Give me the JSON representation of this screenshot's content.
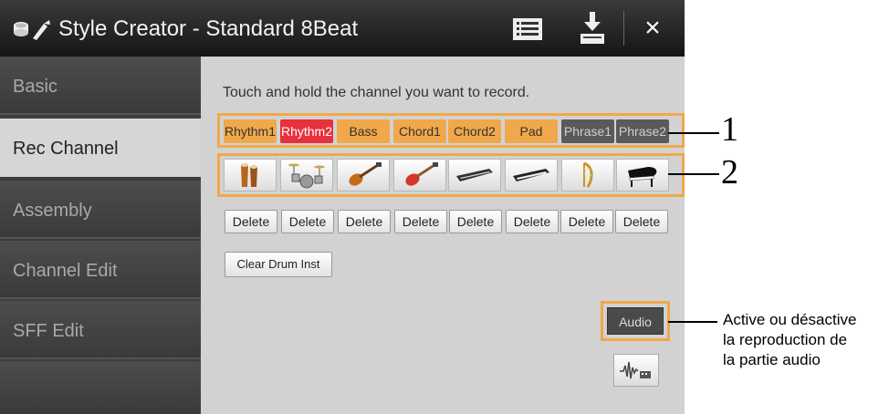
{
  "window": {
    "title": "Style Creator - Standard 8Beat",
    "app_icon": "style-creator-icon",
    "menu_icon": "list-menu-icon",
    "save_icon": "save-download-icon",
    "close_label": "×"
  },
  "sidebar": {
    "items": [
      {
        "label": "Basic",
        "active": false
      },
      {
        "label": "Rec Channel",
        "active": true
      },
      {
        "label": "Assembly",
        "active": false
      },
      {
        "label": "Channel Edit",
        "active": false
      },
      {
        "label": "SFF Edit",
        "active": false
      },
      {
        "label": "",
        "active": false
      }
    ]
  },
  "main": {
    "instruction": "Touch and hold the channel you want to record.",
    "channels": [
      {
        "label": "Rhythm1",
        "state": "orange"
      },
      {
        "label": "Rhythm2",
        "state": "red"
      },
      {
        "label": "Bass",
        "state": "orange"
      },
      {
        "label": "Chord1",
        "state": "orange"
      },
      {
        "label": "Chord2",
        "state": "orange"
      },
      {
        "label": "Pad",
        "state": "orange"
      },
      {
        "label": "Phrase1",
        "state": "dark"
      },
      {
        "label": "Phrase2",
        "state": "dark"
      }
    ],
    "instruments": [
      "conga-icon",
      "drum-kit-icon",
      "bass-guitar-icon",
      "electric-guitar-icon",
      "synth-keyboard-icon",
      "keyboard-icon",
      "harp-icon",
      "grand-piano-icon"
    ],
    "delete_label": "Delete",
    "clear_drum_label": "Clear Drum Inst",
    "audio_label": "Audio",
    "wave_icon": "audio-wave-icon"
  },
  "callouts": {
    "one": "1",
    "two": "2",
    "audio_lines": [
      "Active ou désactive",
      "la reproduction de",
      "la partie audio"
    ]
  },
  "colors": {
    "accent_orange": "#f0a84a",
    "selected_red": "#e8313b",
    "inactive_dark": "#5a5a5a"
  }
}
